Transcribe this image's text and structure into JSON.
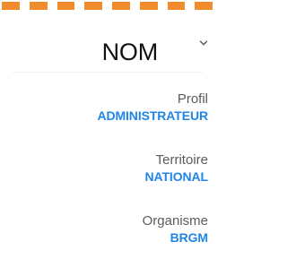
{
  "user": {
    "name": "NOM"
  },
  "details": [
    {
      "label": "Profil",
      "value": "ADMINISTRATEUR"
    },
    {
      "label": "Territoire",
      "value": "NATIONAL"
    },
    {
      "label": "Organisme",
      "value": "BRGM"
    }
  ],
  "colors": {
    "accent_dashes": "#f08c2d",
    "value_text": "#1f86e8",
    "label_text": "#5b5b5b",
    "name_text": "#111111"
  },
  "icons": {
    "expand": "chevron-down-icon"
  }
}
